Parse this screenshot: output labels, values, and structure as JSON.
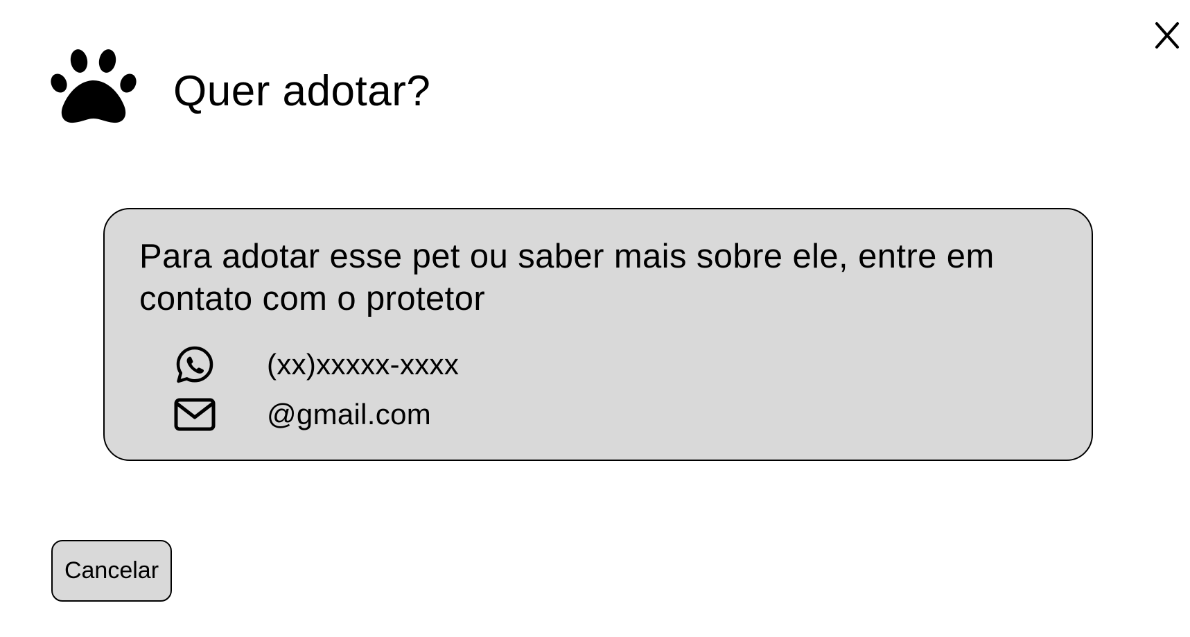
{
  "dialog": {
    "title": "Quer adotar?",
    "close_icon": "close-icon",
    "header_icon": "paw-icon"
  },
  "info": {
    "message": "Para adotar esse pet ou saber mais sobre ele, entre em contato com o protetor",
    "contacts": [
      {
        "icon": "whatsapp-icon",
        "value": "(xx)xxxxx-xxxx"
      },
      {
        "icon": "mail-icon",
        "value": "@gmail.com"
      }
    ]
  },
  "footer": {
    "cancel_label": "Cancelar"
  },
  "colors": {
    "box_background": "#d9d9d9",
    "border": "#000000",
    "text": "#000000",
    "page_background": "#ffffff"
  }
}
